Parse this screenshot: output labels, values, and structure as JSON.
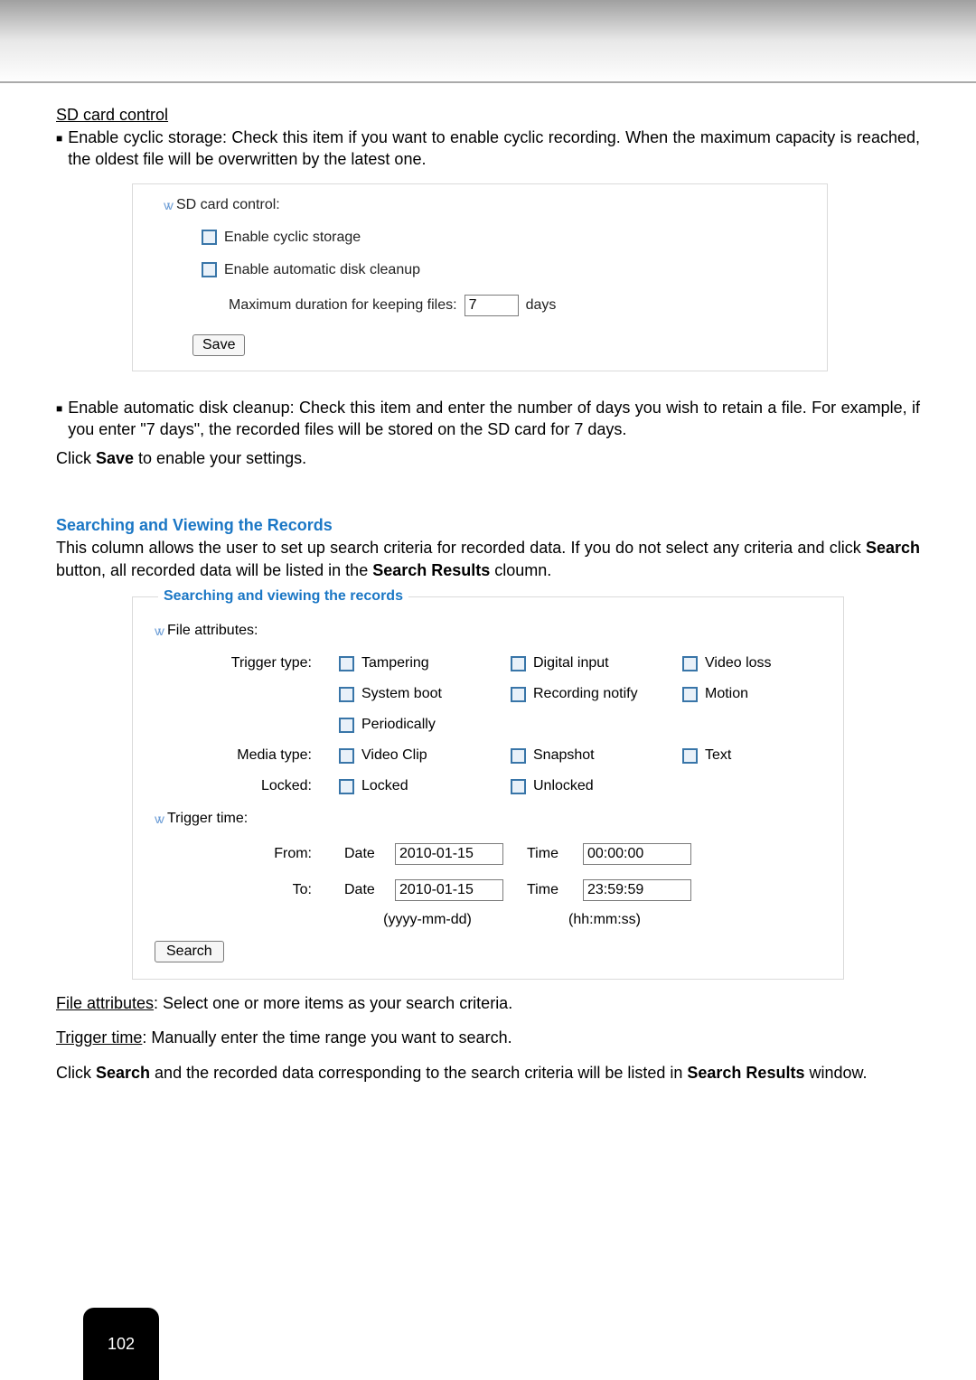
{
  "page_number": "102",
  "sd": {
    "heading": "SD card control",
    "bullet1": "Enable cyclic storage: Check this item if you want to enable cyclic recording. When the maximum capacity is reached, the oldest file will be overwritten by the latest one.",
    "panel": {
      "title": "SD card control:",
      "cb_cyclic": "Enable cyclic storage",
      "cb_cleanup": "Enable automatic disk cleanup",
      "max_dur_label": "Maximum duration for keeping files:",
      "max_dur_value": "7",
      "max_dur_unit": "days",
      "save": "Save"
    },
    "bullet2": "Enable automatic disk cleanup: Check this item and enter the number of days you wish to retain a file. For example, if you enter \"7 days\", the recorded files will be stored on the SD card for 7 days.",
    "save_line_a": "Click ",
    "save_line_b": "Save",
    "save_line_c": " to enable your settings."
  },
  "search": {
    "heading": "Searching and Viewing the Records",
    "intro_a": "This column allows the user to set up search criteria for recorded data. If you do not select any criteria and click ",
    "intro_b": "Search",
    "intro_c": " button, all recorded data will be listed in the ",
    "intro_d": "Search Results",
    "intro_e": " cloumn.",
    "legend": "Searching and viewing the records",
    "file_attr": "File attributes:",
    "trigger_type_label": "Trigger type:",
    "cb": {
      "tampering": "Tampering",
      "digital_input": "Digital input",
      "video_loss": "Video loss",
      "system_boot": "System boot",
      "recording_notify": "Recording notify",
      "motion": "Motion",
      "periodically": "Periodically",
      "video_clip": "Video Clip",
      "snapshot": "Snapshot",
      "text": "Text",
      "locked": "Locked",
      "unlocked": "Unlocked"
    },
    "media_type_label": "Media type:",
    "locked_label": "Locked:",
    "trigger_time": "Trigger time:",
    "from_label": "From:",
    "to_label": "To:",
    "date_label": "Date",
    "time_label": "Time",
    "from_date": "2010-01-15",
    "from_time": "00:00:00",
    "to_date": "2010-01-15",
    "to_time": "23:59:59",
    "hint_date": "(yyyy-mm-dd)",
    "hint_time": "(hh:mm:ss)",
    "search_btn": "Search",
    "after1_u": "File attributes",
    "after1_rest": ": Select one or more items as your search criteria.",
    "after2_u": "Trigger time",
    "after2_rest": ": Manually enter the time range you want to search.",
    "after3_a": "Click ",
    "after3_b": "Search",
    "after3_c": " and the recorded data corresponding to the search criteria will be listed in ",
    "after3_d": "Search Results",
    "after3_e": " window."
  }
}
